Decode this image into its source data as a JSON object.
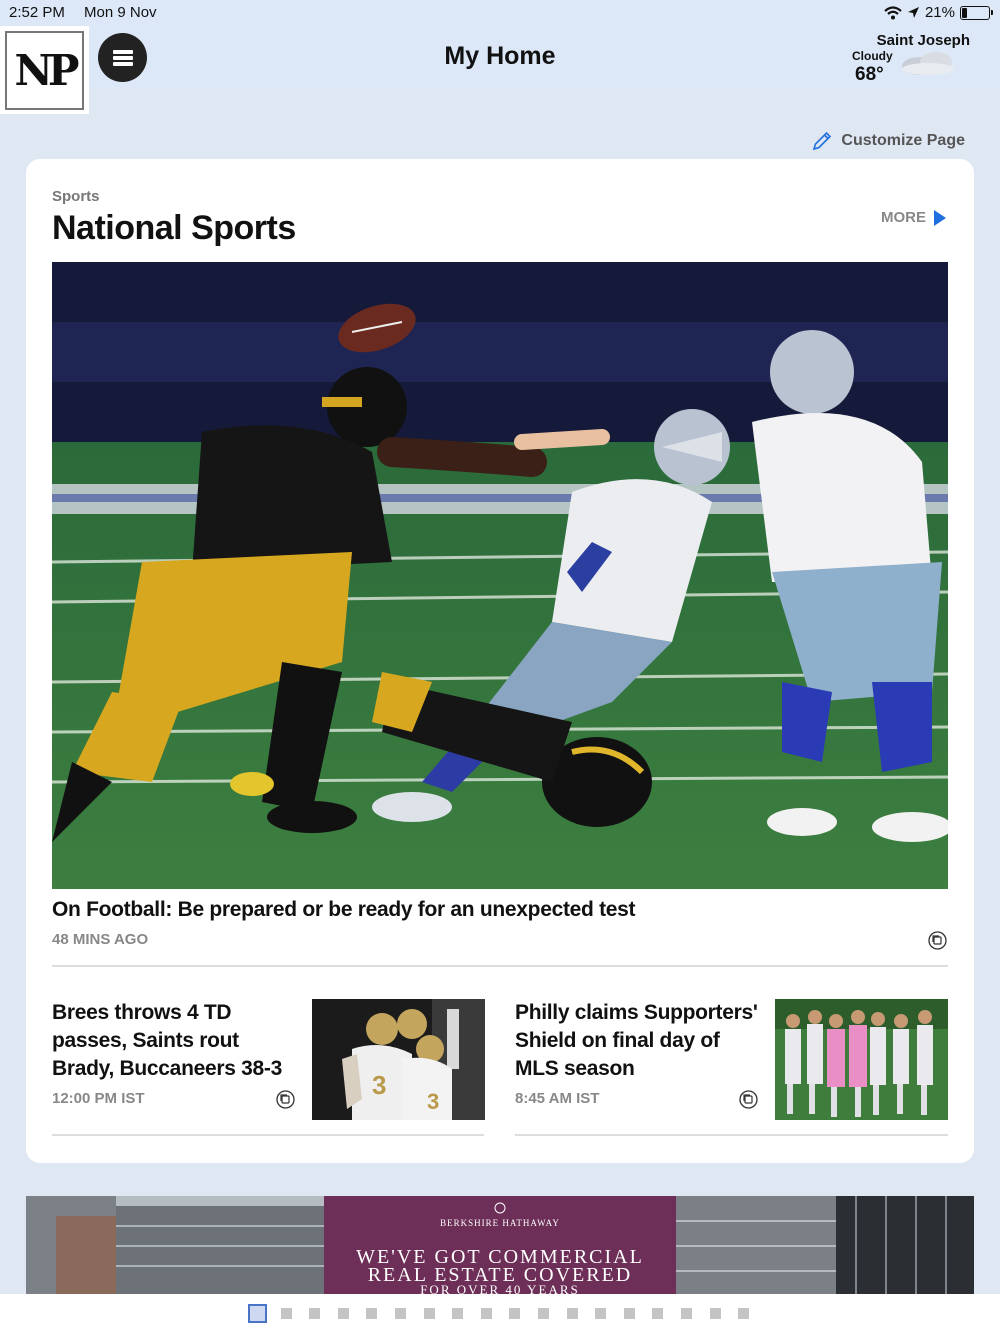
{
  "status_bar": {
    "time": "2:52 PM",
    "date": "Mon 9 Nov",
    "battery": "21%",
    "battery_level": 0.21
  },
  "header": {
    "logo_text": "NP",
    "title": "My Home",
    "weather": {
      "city": "Saint Joseph",
      "condition": "Cloudy",
      "temperature": "68°",
      "icon": "cloud-icon"
    }
  },
  "toolbar": {
    "customize_label": "Customize Page",
    "customize_icon": "pencil-icon"
  },
  "section": {
    "kicker": "Sports",
    "title": "National Sports",
    "more_label": "MORE"
  },
  "hero_story": {
    "headline": "On Football: Be prepared or be ready for an unexpected test",
    "time": "48 MINS AGO"
  },
  "stories": [
    {
      "headline": "Brees throws 4 TD passes, Saints rout Brady, Buccaneers 38-3",
      "time": "12:00 PM IST"
    },
    {
      "headline": "Philly claims Supporters' Shield on final day of MLS season",
      "time": "8:45 AM IST"
    }
  ],
  "ad": {
    "brand": "BERKSHIRE HATHAWAY",
    "line1": "WE'VE GOT COMMERCIAL",
    "line2": "REAL ESTATE COVERED",
    "line3": "FOR OVER 40 YEARS"
  },
  "pager": {
    "page_count": 18,
    "current_page": 1
  },
  "colors": {
    "header_bg": "#dce8f8",
    "page_bg": "#dfe7f3",
    "accent_blue": "#1f6fe0",
    "ad_purple": "#6d2f57"
  }
}
